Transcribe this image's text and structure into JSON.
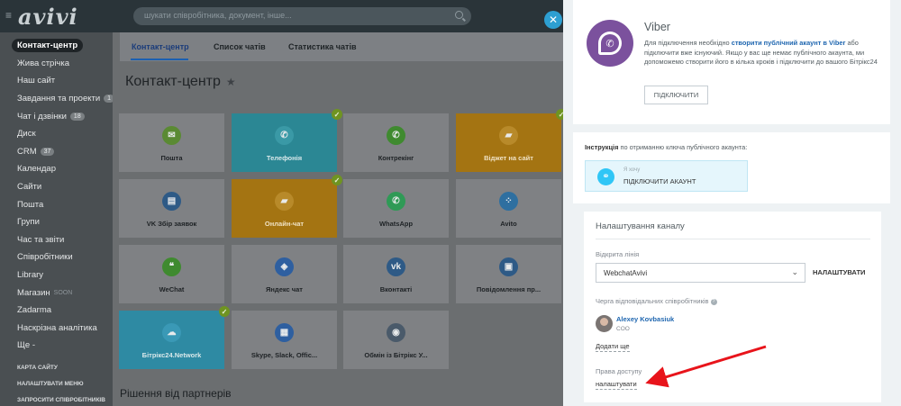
{
  "topbar": {
    "logo": "avivi",
    "search_placeholder": "шукати співробітника, документ, інше..."
  },
  "left_menu": {
    "items": [
      {
        "label": "Контакт-центр",
        "active": true
      },
      {
        "label": "Жива стрічка"
      },
      {
        "label": "Наш сайт"
      },
      {
        "label": "Завдання та проекти",
        "counter": "1"
      },
      {
        "label": "Чат і дзвінки",
        "counter": "18"
      },
      {
        "label": "Диск"
      },
      {
        "label": "CRM",
        "counter": "37"
      },
      {
        "label": "Календар"
      },
      {
        "label": "Сайти"
      },
      {
        "label": "Пошта"
      },
      {
        "label": "Групи"
      },
      {
        "label": "Час та звіти"
      },
      {
        "label": "Співробітники"
      },
      {
        "label": "Library"
      },
      {
        "label": "Магазин",
        "soon": "SOON"
      },
      {
        "label": "Zadarma"
      },
      {
        "label": "Наскрізна аналітика"
      },
      {
        "label": "Ще -"
      }
    ],
    "footer": [
      "КАРТА САЙТУ",
      "НАЛАШТУВАТИ МЕНЮ",
      "ЗАПРОСИТИ СПІВРОБІТНИКІВ"
    ]
  },
  "main": {
    "tabs": [
      "Контакт-центр",
      "Список чатів",
      "Статистика чатів"
    ],
    "title": "Контакт-центр",
    "tiles": [
      {
        "label": "Пошта",
        "icon": "mail-icon",
        "glyph": "✉",
        "color": "#5a8a33",
        "state": ""
      },
      {
        "label": "Телефонія",
        "icon": "phone-icon",
        "glyph": "✆",
        "color": "#3a99a6",
        "state": "blue",
        "checked": true
      },
      {
        "label": "Контрекінг",
        "icon": "phone-tracking-icon",
        "glyph": "✆",
        "color": "#3f8a2f",
        "state": ""
      },
      {
        "label": "Віджет на сайт",
        "icon": "chat-widget-icon",
        "glyph": "▰",
        "color": "#b88a2a",
        "state": "orange",
        "checked": true
      },
      {
        "label": "VK Збір заявок",
        "icon": "vk-form-icon",
        "glyph": "▤",
        "color": "#2e5a86",
        "state": ""
      },
      {
        "label": "Онлайн-чат",
        "icon": "online-chat-icon",
        "glyph": "▰",
        "color": "#b88a2a",
        "state": "orange",
        "checked": true
      },
      {
        "label": "WhatsApp",
        "icon": "whatsapp-icon",
        "glyph": "✆",
        "color": "#2f9a56",
        "state": ""
      },
      {
        "label": "Avito",
        "icon": "avito-icon",
        "glyph": "⁘",
        "color": "#2e6fa0",
        "state": ""
      },
      {
        "label": "WeChat",
        "icon": "wechat-icon",
        "glyph": "❝",
        "color": "#3f8a2f",
        "state": ""
      },
      {
        "label": "Яндекс чат",
        "icon": "yandex-chat-icon",
        "glyph": "◈",
        "color": "#2e5fa0",
        "state": ""
      },
      {
        "label": "Вконтакті",
        "icon": "vk-icon",
        "glyph": "vk",
        "color": "#2e5a86",
        "state": ""
      },
      {
        "label": "Повідомлення пр...",
        "icon": "shop-message-icon",
        "glyph": "▣",
        "color": "#2e5a86",
        "state": ""
      },
      {
        "label": "Бітрікс24.Network",
        "icon": "cloud-icon",
        "glyph": "☁",
        "color": "#3a99b6",
        "state": "cyan",
        "checked": true
      },
      {
        "label": "Skype, Slack, Offic...",
        "icon": "apps-icon",
        "glyph": "▦",
        "color": "#2e5fa0",
        "state": ""
      },
      {
        "label": "Обмін із Бітрікс У...",
        "icon": "exchange-icon",
        "glyph": "◉",
        "color": "#4a5a6a",
        "state": ""
      }
    ],
    "partners_title": "Рішення від партнерів"
  },
  "panel": {
    "viber": {
      "title": "Viber",
      "desc_1": "Для підключення необхідно ",
      "desc_link": "створити публічний акаунт в Viber",
      "desc_2": " або підключити вже існуючий. Якщо у вас ще немає публічного акаунта, ми допоможемо створити його в кілька кроків і підключити до вашого Бітрікс24",
      "connect_button": "ПІДКЛЮЧИТИ"
    },
    "instruction": {
      "label_bold": "Інструкція",
      "label_rest": " по отриманню ключа публічного акаунта:",
      "small": "Я хочу",
      "main": "ПІДКЛЮЧИТИ АКАУНТ"
    },
    "settings": {
      "title": "Налаштування каналу",
      "open_line_label": "Відкрита лінія",
      "open_line_value": "WebchatAvivi",
      "setup_button": "НАЛАШТУВАТИ",
      "queue_label": "Черга відповідальних співробітників",
      "user_name": "Alexey Kovbasiuk",
      "user_role": "COO",
      "add_link": "Додати ще",
      "access_label": "Права доступу",
      "access_link": "налаштувати"
    },
    "annotation_color": "#e8141b"
  }
}
